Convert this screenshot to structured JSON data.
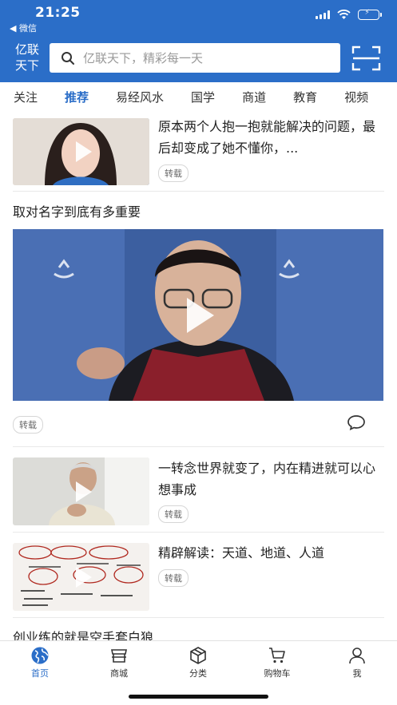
{
  "status_bar": {
    "time": "21:25",
    "back_label": "◀ 微信"
  },
  "header": {
    "logo_line1": "亿联",
    "logo_line2": "天下",
    "search_placeholder": "亿联天下，精彩每一天",
    "scan_icon": "scan-icon"
  },
  "tabs": [
    "关注",
    "推荐",
    "易经风水",
    "国学",
    "商道",
    "教育",
    "视频"
  ],
  "active_tab": "推荐",
  "feed": {
    "item1": {
      "title": "原本两个人抱一抱就能解决的问题，最后却变成了她不懂你，...",
      "tag": "转载"
    },
    "item2": {
      "title": "取对名字到底有多重要",
      "tag": "转载",
      "icon": "comment-icon"
    },
    "item3": {
      "title": "一转念世界就变了，内在精进就可以心想事成",
      "tag": "转载"
    },
    "item4": {
      "title": "精辟解读：天道、地道、人道",
      "tag": "转载"
    },
    "item5": {
      "title": "创业练的就是空手套白狼"
    }
  },
  "bottom_nav": [
    {
      "label": "首页",
      "icon": "globe-icon",
      "active": true
    },
    {
      "label": "商城",
      "icon": "store-icon",
      "active": false
    },
    {
      "label": "分类",
      "icon": "box-icon",
      "active": false
    },
    {
      "label": "购物车",
      "icon": "cart-icon",
      "active": false
    },
    {
      "label": "我",
      "icon": "user-icon",
      "active": false
    }
  ],
  "colors": {
    "brand": "#2b6ec8",
    "battery": "#58d66a"
  }
}
